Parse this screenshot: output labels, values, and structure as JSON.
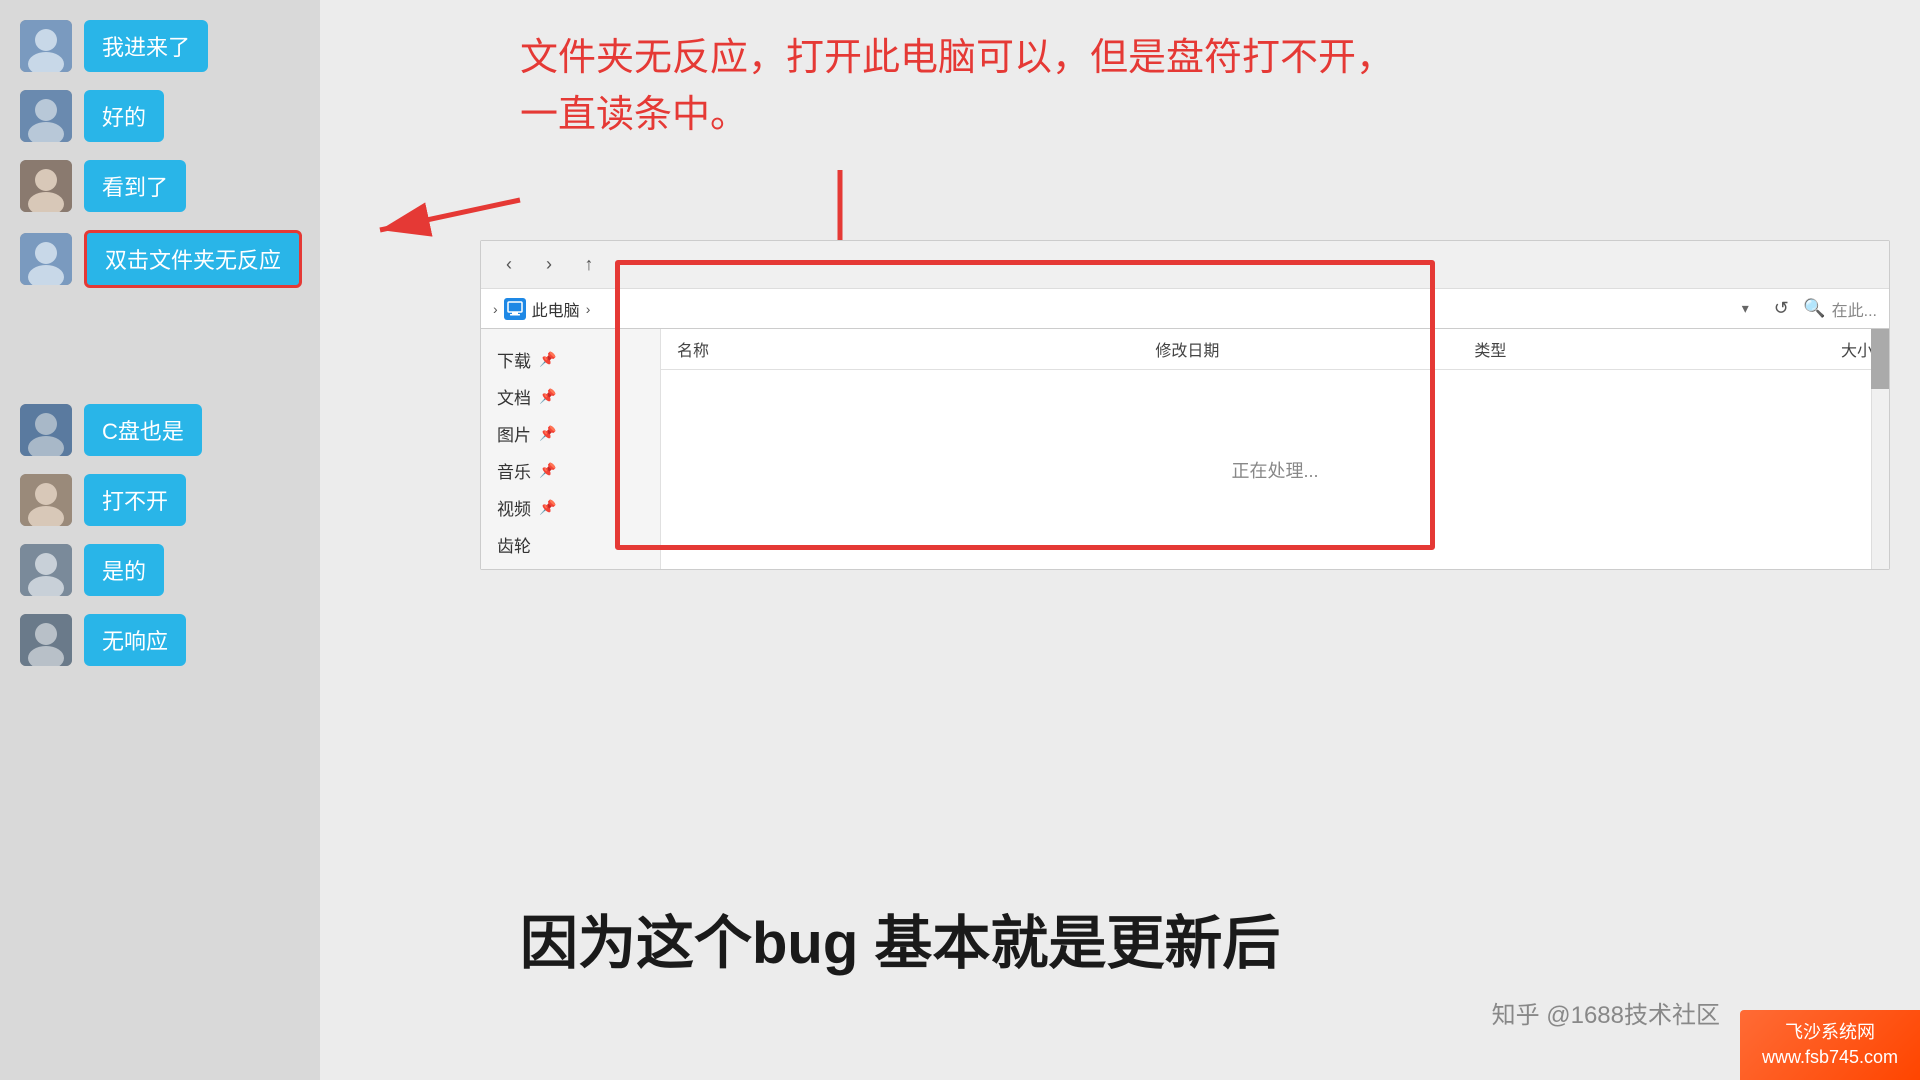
{
  "chat": {
    "items": [
      {
        "id": 1,
        "text": "我进来了",
        "highlighted": false
      },
      {
        "id": 2,
        "text": "好的",
        "highlighted": false
      },
      {
        "id": 3,
        "text": "看到了",
        "highlighted": false
      },
      {
        "id": 4,
        "text": "双击文件夹无反应",
        "highlighted": true
      },
      {
        "id": 5,
        "text": "C盘也是",
        "highlighted": false
      },
      {
        "id": 6,
        "text": "打不开",
        "highlighted": false
      },
      {
        "id": 7,
        "text": "是的",
        "highlighted": false
      },
      {
        "id": 8,
        "text": "无响应",
        "highlighted": false
      }
    ]
  },
  "annotation": {
    "line1": "文件夹无反应，打开此电脑可以，但是盘符打不开，",
    "line2": "一直读条中。"
  },
  "explorer": {
    "breadcrumb": "此电脑",
    "breadcrumb_sep": ">",
    "search_placeholder": "在此...",
    "columns": {
      "name": "名称",
      "date": "修改日期",
      "type": "类型",
      "size": "大小"
    },
    "status": "正在处理...",
    "sidebar_items": [
      {
        "label": "下载"
      },
      {
        "label": "文档"
      },
      {
        "label": "图片"
      },
      {
        "label": "音乐"
      },
      {
        "label": "视频"
      },
      {
        "label": "齿轮"
      }
    ]
  },
  "subtitle": "因为这个bug 基本就是更新后",
  "watermark": "知乎 @1688技术社区",
  "logo": {
    "line1": "飞沙系统网",
    "line2": "www.fsb745.com"
  }
}
